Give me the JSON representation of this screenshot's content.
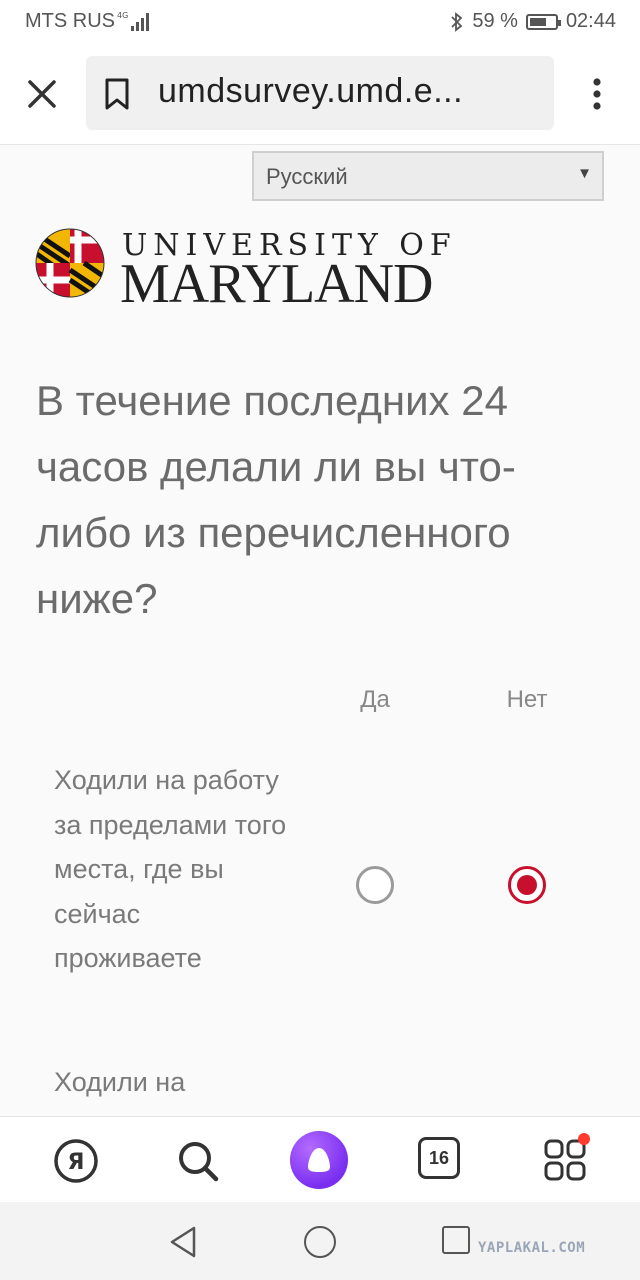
{
  "status_bar": {
    "carrier": "MTS RUS",
    "battery": "59 %",
    "time": "02:44"
  },
  "browser": {
    "url": "umdsurvey.umd.e..."
  },
  "language_select": {
    "selected": "Русский"
  },
  "logo": {
    "line1": "UNIVERSITY OF",
    "line2": "MARYLAND"
  },
  "survey": {
    "question": "В течение последних 24 часов делали ли вы что-либо из перечисленного ниже?",
    "columns": [
      "Да",
      "Нет"
    ],
    "items": [
      {
        "label": "Ходили на работу за пределами того места, где вы сейчас проживаете",
        "answer": "Нет"
      },
      {
        "label": "Ходили на",
        "answer": null
      }
    ]
  },
  "toolbar": {
    "tab_count": "16"
  },
  "watermark": "YAPLAKAL.COM",
  "colors": {
    "accent_red": "#c8102e",
    "alice_purple": "#7a2ff0"
  }
}
